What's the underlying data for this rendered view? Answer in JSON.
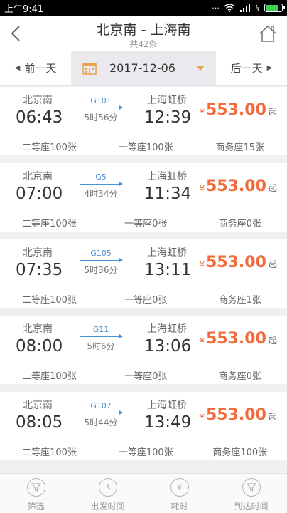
{
  "status_bar": {
    "time": "上午9:41"
  },
  "header": {
    "title": "北京南 - 上海南",
    "subtitle": "共42条"
  },
  "date_bar": {
    "prev_label": "前一天",
    "date": "2017-12-06",
    "next_label": "后一天"
  },
  "trains": [
    {
      "from": "北京南",
      "dep": "06:43",
      "no": "G101",
      "duration": "5时56分",
      "to": "上海虹桥",
      "arr": "12:39",
      "currency": "¥",
      "price": "553.00",
      "price_suffix": "起",
      "seat2": "二等座100张",
      "seat1": "一等座100张",
      "seatb": "商务座15张"
    },
    {
      "from": "北京南",
      "dep": "07:00",
      "no": "G5",
      "duration": "4时34分",
      "to": "上海虹桥",
      "arr": "11:34",
      "currency": "¥",
      "price": "553.00",
      "price_suffix": "起",
      "seat2": "二等座100张",
      "seat1": "一等座0张",
      "seatb": "商务座0张"
    },
    {
      "from": "北京南",
      "dep": "07:35",
      "no": "G105",
      "duration": "5时36分",
      "to": "上海虹桥",
      "arr": "13:11",
      "currency": "¥",
      "price": "553.00",
      "price_suffix": "起",
      "seat2": "二等座100张",
      "seat1": "一等座0张",
      "seatb": "商务座1张"
    },
    {
      "from": "北京南",
      "dep": "08:00",
      "no": "G11",
      "duration": "5时6分",
      "to": "上海虹桥",
      "arr": "13:06",
      "currency": "¥",
      "price": "553.00",
      "price_suffix": "起",
      "seat2": "二等座100张",
      "seat1": "一等座0张",
      "seatb": "商务座0张"
    },
    {
      "from": "北京南",
      "dep": "08:05",
      "no": "G107",
      "duration": "5时44分",
      "to": "上海虹桥",
      "arr": "13:49",
      "currency": "¥",
      "price": "553.00",
      "price_suffix": "起",
      "seat2": "二等座100张",
      "seat1": "一等座100张",
      "seatb": "商务座100张"
    }
  ],
  "tabs": [
    {
      "label": "筛选",
      "icon": "filter-icon"
    },
    {
      "label": "出发时间",
      "icon": "clock-icon"
    },
    {
      "label": "耗时",
      "icon": "yen-icon"
    },
    {
      "label": "到达时间",
      "icon": "filter-icon"
    }
  ],
  "colors": {
    "price": "#f36a3c",
    "train_no": "#4a90d9",
    "caret": "#e9a249",
    "battery": "#3fd24a"
  }
}
